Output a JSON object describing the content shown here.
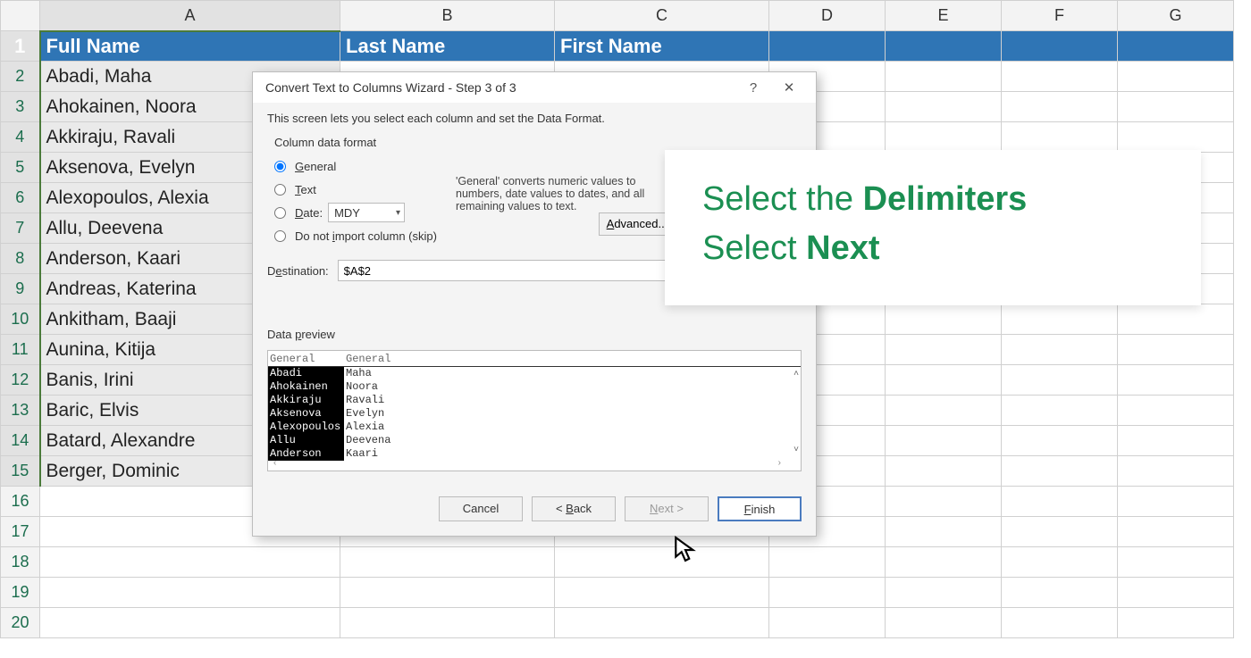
{
  "sheet": {
    "columns": [
      "A",
      "B",
      "C",
      "D",
      "E",
      "F",
      "G"
    ],
    "row_count": 20,
    "headers": {
      "a": "Full Name",
      "b": "Last Name",
      "c": "First Name"
    },
    "data": [
      "Abadi, Maha",
      "Ahokainen, Noora",
      "Akkiraju, Ravali",
      "Aksenova, Evelyn",
      "Alexopoulos, Alexia",
      "Allu, Deevena",
      "Anderson, Kaari",
      "Andreas, Katerina",
      "Ankitham, Baaji",
      "Aunina, Kitija",
      "Banis, Irini",
      "Baric, Elvis",
      "Batard, Alexandre",
      "Berger, Dominic"
    ]
  },
  "dialog": {
    "title": "Convert Text to Columns Wizard - Step 3 of 3",
    "help_glyph": "?",
    "close_glyph": "✕",
    "description": "This screen lets you select each column and set the Data Format.",
    "group_title": "Column data format",
    "radio_general": "General",
    "radio_text": "Text",
    "radio_date": "Date:",
    "date_format": "MDY",
    "radio_skip": "Do not import column (skip)",
    "info_text": "'General' converts numeric values to numbers, date values to dates, and all remaining values to text.",
    "advanced_btn": "Advanced...",
    "destination_label": "Destination:",
    "destination_value": "$A$2",
    "preview_label": "Data preview",
    "preview_col_header1": "General",
    "preview_col_header2": "General",
    "preview_rows": [
      {
        "c1": "Abadi",
        "c2": "Maha"
      },
      {
        "c1": "Ahokainen",
        "c2": "Noora"
      },
      {
        "c1": "Akkiraju",
        "c2": "Ravali"
      },
      {
        "c1": "Aksenova",
        "c2": "Evelyn"
      },
      {
        "c1": "Alexopoulos",
        "c2": "Alexia"
      },
      {
        "c1": "Allu",
        "c2": "Deevena"
      },
      {
        "c1": "Anderson",
        "c2": "Kaari"
      }
    ],
    "buttons": {
      "cancel": "Cancel",
      "back": "< Back",
      "next": "Next >",
      "finish": "Finish"
    }
  },
  "callout": {
    "line1a": "Select the ",
    "line1b": "Delimiters",
    "line2a": "Select ",
    "line2b": "Next"
  }
}
